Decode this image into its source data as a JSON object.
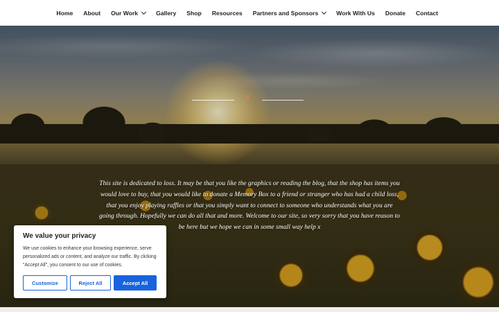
{
  "nav": {
    "items": [
      {
        "label": "Home",
        "dropdown": false
      },
      {
        "label": "About",
        "dropdown": false
      },
      {
        "label": "Our Work",
        "dropdown": true
      },
      {
        "label": "Gallery",
        "dropdown": false
      },
      {
        "label": "Shop",
        "dropdown": false
      },
      {
        "label": "Resources",
        "dropdown": false
      },
      {
        "label": "Partners and Sponsors",
        "dropdown": true
      },
      {
        "label": "Work With Us",
        "dropdown": false
      },
      {
        "label": "Donate",
        "dropdown": false
      },
      {
        "label": "Contact",
        "dropdown": false
      }
    ]
  },
  "hero": {
    "tagline": "This site is dedicated to loss.  It may be that you like the graphics or reading the blog, that the shop has items you would love to buy, that you would like to donate a Memory Box to a friend or stranger who has had a child loss, that you enjoy playing raffles or that you simply want to connect to someone who understands what you are going through.  Hopefully we can do all that and more.  Welcome to our site, so very sorry that you have reason to be here but we hope we can in some small way help x"
  },
  "cookie_banner": {
    "title": "We value your privacy",
    "text": "We use cookies to enhance your browsing experience, serve personalized ads or content, and analyze our traffic. By clicking \"Accept All\", you consent to our use of cookies.",
    "customize_label": "Customize",
    "reject_label": "Reject All",
    "accept_label": "Accept All",
    "accent_color": "#1863dc"
  }
}
